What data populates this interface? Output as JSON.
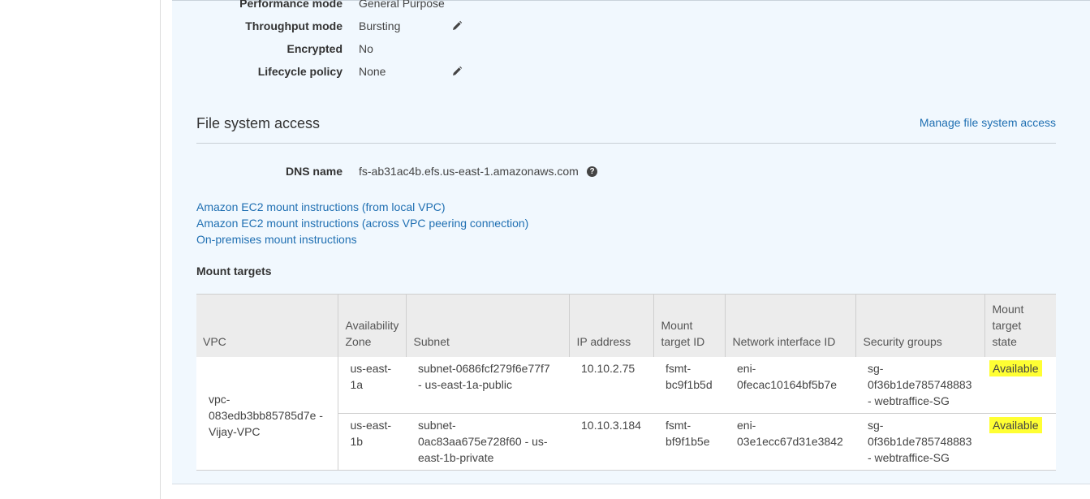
{
  "properties": [
    {
      "label": "Performance mode",
      "value": "General Purpose",
      "editable": false
    },
    {
      "label": "Throughput mode",
      "value": "Bursting",
      "editable": true
    },
    {
      "label": "Encrypted",
      "value": "No",
      "editable": false
    },
    {
      "label": "Lifecycle policy",
      "value": "None",
      "editable": true
    }
  ],
  "access": {
    "title": "File system access",
    "manage_link": "Manage file system access",
    "dns_label": "DNS name",
    "dns_value": "fs-ab31ac4b.efs.us-east-1.amazonaws.com",
    "help_glyph": "?",
    "links": [
      "Amazon EC2 mount instructions (from local VPC)",
      "Amazon EC2 mount instructions (across VPC peering connection)",
      "On-premises mount instructions"
    ]
  },
  "mount_targets": {
    "title": "Mount targets",
    "columns": [
      "VPC",
      "Availability Zone",
      "Subnet",
      "IP address",
      "Mount target ID",
      "Network interface ID",
      "Security groups",
      "Mount target state"
    ],
    "vpc": "vpc-083edb3bb85785d7e - Vijay-VPC",
    "rows": [
      {
        "az": "us-east-1a",
        "subnet": "subnet-0686fcf279f6e77f7 - us-east-1a-public",
        "ip": "10.10.2.75",
        "mount_target_id": "fsmt-bc9f1b5d",
        "eni": "eni-0fecac10164bf5b7e",
        "security_groups": "sg-0f36b1de785748883 - webtraffice-SG",
        "state": "Available"
      },
      {
        "az": "us-east-1b",
        "subnet": "subnet-0ac83aa675e728f60 - us-east-1b-private",
        "ip": "10.10.3.184",
        "mount_target_id": "fsmt-bf9f1b5e",
        "eni": "eni-03e1ecc67d31e3842",
        "security_groups": "sg-0f36b1de785748883 - webtraffice-SG",
        "state": "Available"
      }
    ]
  },
  "colors": {
    "panel_bg": "#f1f8fe",
    "link": "#1f6fb2",
    "highlight": "#ffff33"
  },
  "icons": {
    "edit": "pencil-icon",
    "help": "help-circle-icon"
  }
}
